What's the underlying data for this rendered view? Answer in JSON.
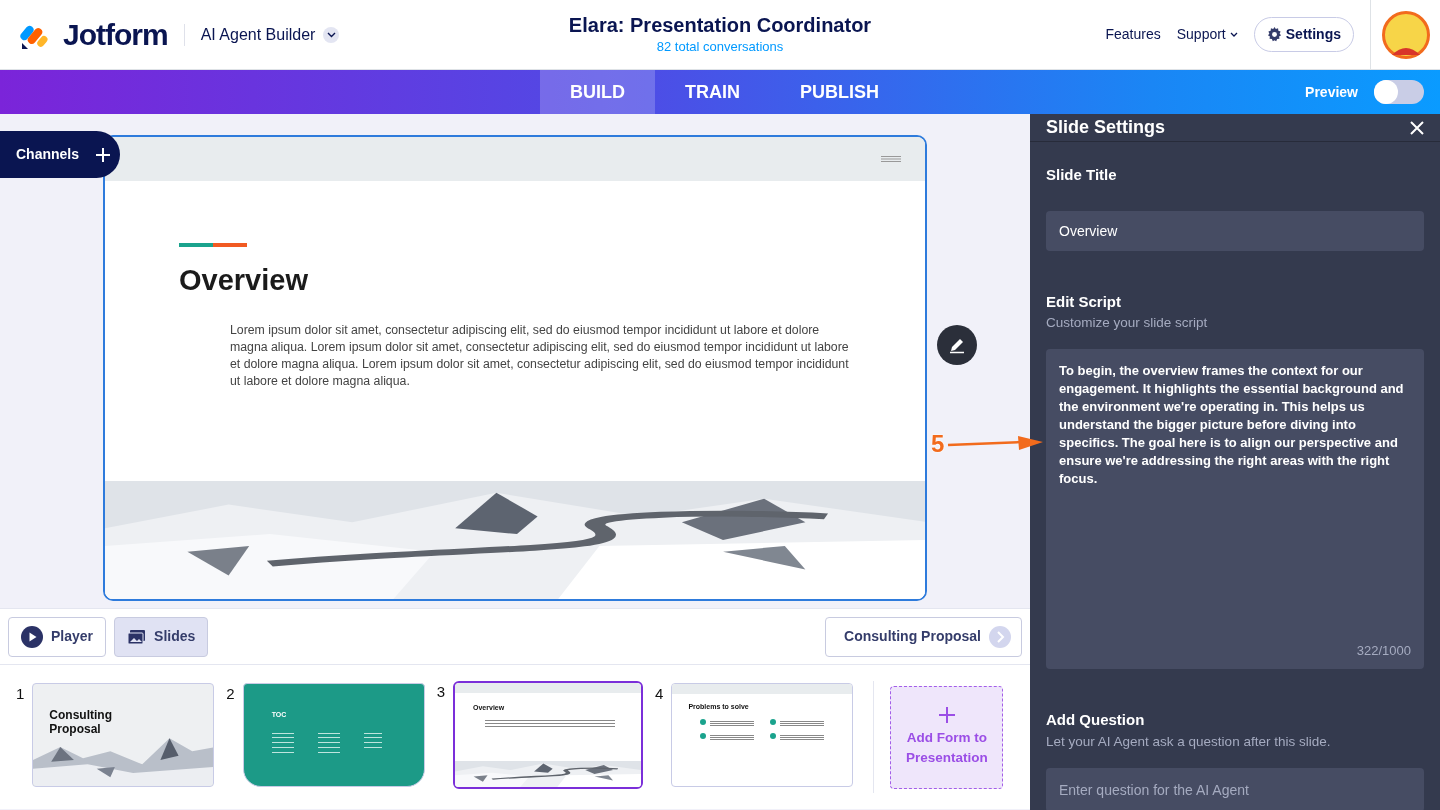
{
  "header": {
    "logo": "Jotform",
    "product": "AI Agent Builder",
    "title": "Elara: Presentation Coordinator",
    "subtitle": "82 total conversations",
    "links": [
      "Features",
      "Support"
    ],
    "settings_button": "Settings"
  },
  "tabs": [
    {
      "label": "BUILD",
      "selected": true
    },
    {
      "label": "TRAIN",
      "selected": false
    },
    {
      "label": "PUBLISH",
      "selected": false
    }
  ],
  "preview": {
    "label": "Preview",
    "on": false
  },
  "channels_button": "Channels",
  "slide": {
    "title": "Overview",
    "body": "Lorem ipsum dolor sit amet, consectetur adipiscing elit, sed do eiusmod tempor incididunt ut labore et dolore magna aliqua. Lorem ipsum dolor sit amet, consectetur adipiscing elit, sed do eiusmod tempor incididunt ut labore et dolore magna aliqua. Lorem ipsum dolor sit amet, consectetur adipiscing elit, sed do eiusmod tempor incididunt ut labore et dolore magna aliqua."
  },
  "toolbar": {
    "views": [
      {
        "label": "Player",
        "kind": "player",
        "selected": false
      },
      {
        "label": "Slides",
        "kind": "slides",
        "selected": true
      }
    ],
    "deck_button": "Consulting Proposal"
  },
  "thumbnails": [
    {
      "number": "1",
      "kind": "cover",
      "title": "Consulting Proposal",
      "selected": false
    },
    {
      "number": "2",
      "kind": "toc",
      "title": "TOC",
      "selected": false
    },
    {
      "number": "3",
      "kind": "content",
      "title": "Overview",
      "selected": true
    },
    {
      "number": "4",
      "kind": "list",
      "title": "Problems to solve",
      "selected": false
    }
  ],
  "add_form_button": "Add Form to Presentation",
  "panel": {
    "title": "Slide Settings",
    "slide_title_label": "Slide Title",
    "slide_title_value": "Overview",
    "script_label": "Edit Script",
    "script_hint": "Customize your slide script",
    "script": "To begin, the overview frames the context for our engagement. It highlights the essential background and the environment we're operating in. This helps us understand the bigger picture before diving into specifics. The goal here is to align our perspective and ensure we're addressing the right areas with the right focus.",
    "counter": "322/1000",
    "question_label": "Add Question",
    "question_hint": "Let your AI Agent ask a question after this slide.",
    "question_placeholder": "Enter question for the AI Agent"
  },
  "callout": {
    "number": "5"
  }
}
